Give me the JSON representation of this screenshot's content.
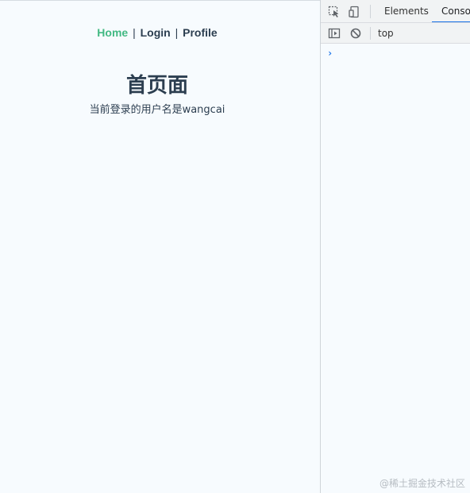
{
  "nav": {
    "home": "Home",
    "sep1": "|",
    "login": "Login",
    "sep2": "|",
    "profile": "Profile"
  },
  "main": {
    "title": "首页面",
    "user_line": "当前登录的用户名是wangcai"
  },
  "devtools": {
    "tabs": [
      {
        "label": "Elements"
      },
      {
        "label": "Consol"
      }
    ],
    "context": "top",
    "prompt": "›",
    "icons": [
      "inspect-icon",
      "device-toggle-icon",
      "sidebar-toggle-icon",
      "clear-console-icon"
    ]
  },
  "watermark": "@稀土掘金技术社区",
  "colors": {
    "active_link": "#42b983",
    "text": "#2c3e50",
    "tab_underline": "#1a73e8"
  }
}
